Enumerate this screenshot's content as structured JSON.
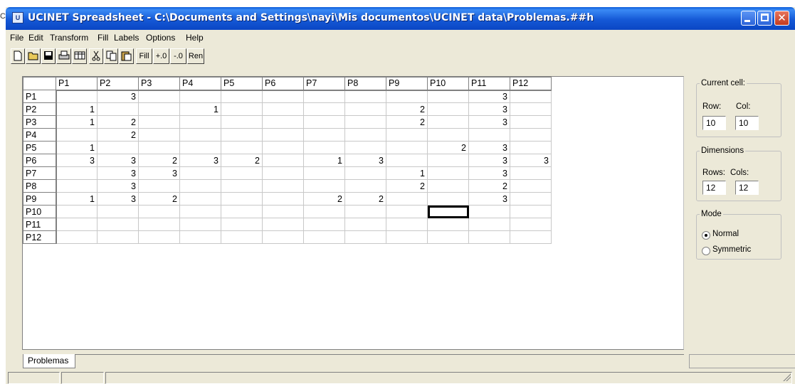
{
  "edge_text": "CIN",
  "window": {
    "title": "UCINET Spreadsheet - C:\\Documents and Settings\\nayi\\Mis documentos\\UCINET data\\Problemas.##h",
    "icon": "ucinet-app-icon"
  },
  "menu": [
    "File",
    "Edit",
    "Transform",
    "Fill",
    "Labels",
    "Options",
    "Help"
  ],
  "toolbar": {
    "icons": [
      "new-file-icon",
      "open-folder-icon",
      "save-icon",
      "print-icon",
      "matrix-icon",
      "cut-icon",
      "copy-icon",
      "paste-icon"
    ],
    "fill_label": "Fill",
    "plus_label": "+.0",
    "minus_label": "-.0",
    "ren_label": "Ren"
  },
  "grid": {
    "columns": [
      "P1",
      "P2",
      "P3",
      "P4",
      "P5",
      "P6",
      "P7",
      "P8",
      "P9",
      "P10",
      "P11",
      "P12"
    ],
    "rows": [
      {
        "label": "P1",
        "cells": [
          "",
          "3",
          "",
          "",
          "",
          "",
          "",
          "",
          "",
          "",
          "3",
          ""
        ]
      },
      {
        "label": "P2",
        "cells": [
          "1",
          "",
          "",
          "1",
          "",
          "",
          "",
          "",
          "2",
          "",
          "3",
          ""
        ]
      },
      {
        "label": "P3",
        "cells": [
          "1",
          "2",
          "",
          "",
          "",
          "",
          "",
          "",
          "2",
          "",
          "3",
          ""
        ]
      },
      {
        "label": "P4",
        "cells": [
          "",
          "2",
          "",
          "",
          "",
          "",
          "",
          "",
          "",
          "",
          "",
          ""
        ]
      },
      {
        "label": "P5",
        "cells": [
          "1",
          "",
          "",
          "",
          "",
          "",
          "",
          "",
          "",
          "2",
          "3",
          ""
        ]
      },
      {
        "label": "P6",
        "cells": [
          "3",
          "3",
          "2",
          "3",
          "2",
          "",
          "1",
          "3",
          "",
          "",
          "3",
          "3"
        ]
      },
      {
        "label": "P7",
        "cells": [
          "",
          "3",
          "3",
          "",
          "",
          "",
          "",
          "",
          "1",
          "",
          "3",
          ""
        ]
      },
      {
        "label": "P8",
        "cells": [
          "",
          "3",
          "",
          "",
          "",
          "",
          "",
          "",
          "2",
          "",
          "2",
          ""
        ]
      },
      {
        "label": "P9",
        "cells": [
          "1",
          "3",
          "2",
          "",
          "",
          "",
          "2",
          "2",
          "",
          "",
          "3",
          ""
        ]
      },
      {
        "label": "P10",
        "cells": [
          "",
          "",
          "",
          "",
          "",
          "",
          "",
          "",
          "",
          "",
          "",
          ""
        ]
      },
      {
        "label": "P11",
        "cells": [
          "",
          "",
          "",
          "",
          "",
          "",
          "",
          "",
          "",
          "",
          "",
          ""
        ]
      },
      {
        "label": "P12",
        "cells": [
          "",
          "",
          "",
          "",
          "",
          "",
          "",
          "",
          "",
          "",
          "",
          ""
        ]
      }
    ]
  },
  "panel": {
    "current_cell": {
      "legend": "Current cell:",
      "row_label": "Row:",
      "col_label": "Col:",
      "row": "10",
      "col": "10"
    },
    "dimensions": {
      "legend": "Dimensions",
      "rows_label": "Rows:",
      "cols_label": "Cols:",
      "rows": "12",
      "cols": "12"
    },
    "mode": {
      "legend": "Mode",
      "normal": "Normal",
      "symmetric": "Symmetric",
      "selected": "Normal"
    }
  },
  "sheet_tab": "Problemas"
}
